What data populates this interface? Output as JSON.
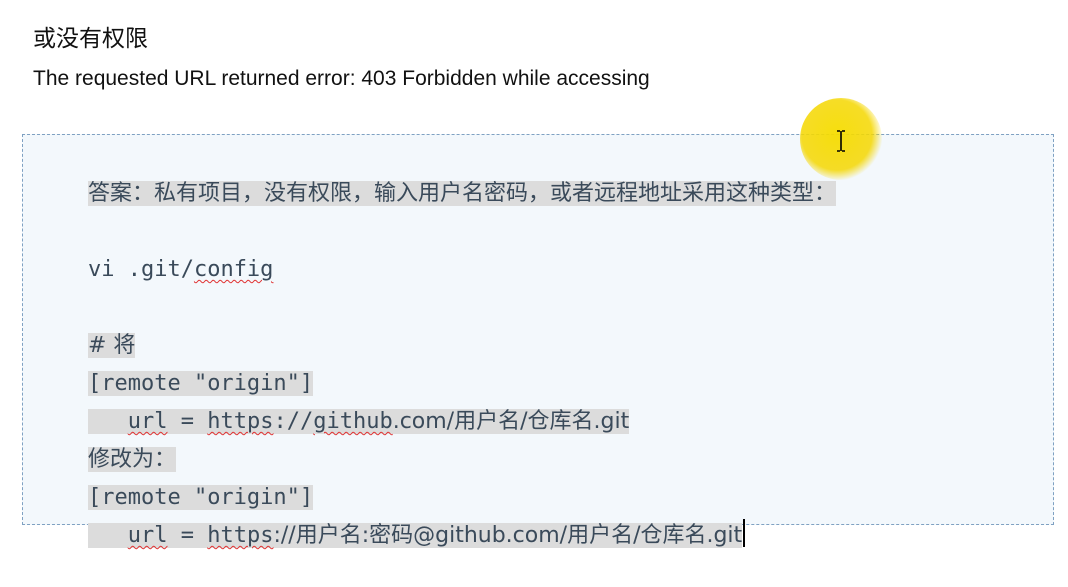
{
  "heading": "或没有权限",
  "error_line": "The requested URL returned error: 403 Forbidden while accessing",
  "code": {
    "answer": "答案：私有项目，没有权限，输入用户名密码，或者远程地址采用这种类型：",
    "vi_cmd_prefix": "vi .git/",
    "vi_cmd_word": "config",
    "comment": "# 将",
    "remote1": "[remote \"origin\"]",
    "url1_key": "url",
    "url1_eq": " = ",
    "url1_proto": "https",
    "url1_sep": "://",
    "url1_host": "github",
    "url1_rest": ".com/用户名/仓库名.git",
    "modify_label": "修改为：",
    "remote2": "[remote \"origin\"]",
    "url2_key": "url",
    "url2_eq": " = ",
    "url2_proto": "https",
    "url2_rest": "://用户名:密码@github.com/用户名/仓库名.git"
  },
  "cursor_highlight_color": "#f5d800"
}
